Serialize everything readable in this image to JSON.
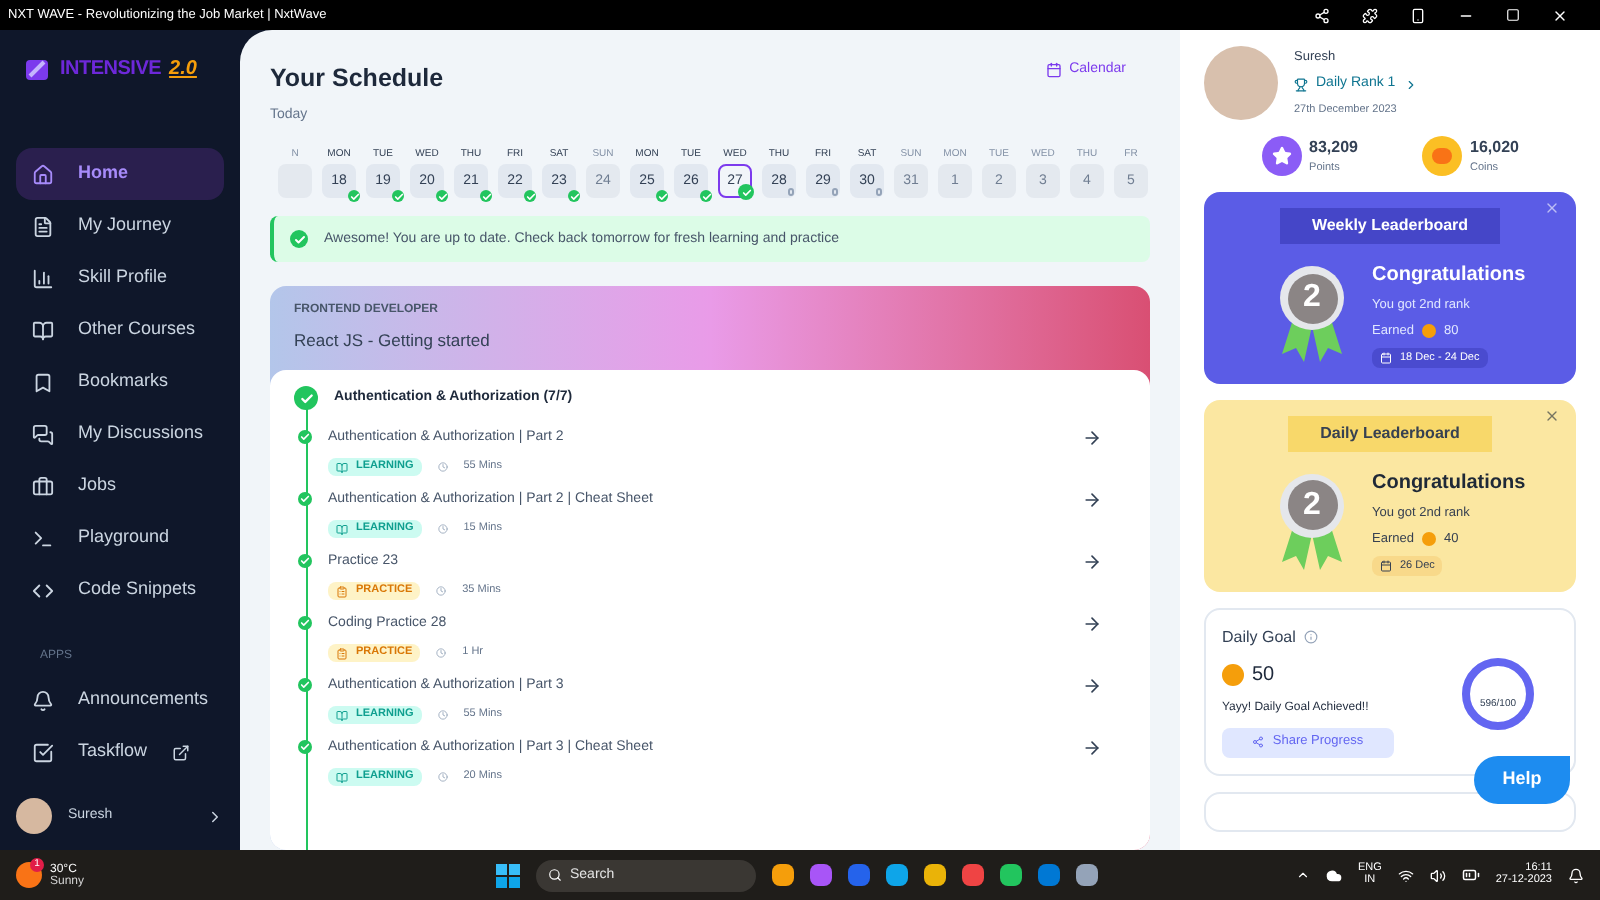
{
  "window": {
    "title": "NXT WAVE - Revolutionizing the Job Market | NxtWave"
  },
  "sidebar": {
    "logo": {
      "word": "INTENSIVE",
      "version": "2.0"
    },
    "items": [
      {
        "label": "Home",
        "selected": true
      },
      {
        "label": "My Journey",
        "selected": false
      },
      {
        "label": "Skill Profile",
        "selected": false
      },
      {
        "label": "Other Courses",
        "selected": false
      },
      {
        "label": "Bookmarks",
        "selected": false
      },
      {
        "label": "My Discussions",
        "selected": false
      },
      {
        "label": "Jobs",
        "selected": false
      },
      {
        "label": "Playground",
        "selected": false
      },
      {
        "label": "Code Snippets",
        "selected": false
      }
    ],
    "section_title": "APPS",
    "apps": [
      {
        "label": "Announcements",
        "selected": false
      },
      {
        "label": "Taskflow",
        "external": true,
        "selected": false
      }
    ],
    "user": {
      "name": "Suresh"
    }
  },
  "schedule": {
    "title": "Your Schedule",
    "subtitle": "Today",
    "calendar_link": "Calendar",
    "days": [
      {
        "day": "N",
        "kind": "none",
        "muted": true,
        "selected": false
      },
      {
        "day": "MON",
        "date": "18",
        "kind": "done",
        "muted": false,
        "selected": false
      },
      {
        "day": "TUE",
        "date": "19",
        "kind": "done",
        "muted": false,
        "selected": false
      },
      {
        "day": "WED",
        "date": "20",
        "kind": "done",
        "muted": false,
        "selected": false
      },
      {
        "day": "THU",
        "date": "21",
        "kind": "done",
        "muted": false,
        "selected": false
      },
      {
        "day": "FRI",
        "date": "22",
        "kind": "done",
        "muted": false,
        "selected": false
      },
      {
        "day": "SAT",
        "date": "23",
        "kind": "done",
        "muted": false,
        "selected": false
      },
      {
        "day": "SUN",
        "date": "24",
        "kind": "none",
        "muted": true,
        "selected": false
      },
      {
        "day": "MON",
        "date": "25",
        "kind": "done",
        "muted": false,
        "selected": false
      },
      {
        "day": "TUE",
        "date": "26",
        "kind": "done",
        "muted": false,
        "selected": false
      },
      {
        "day": "WED",
        "date": "27",
        "kind": "done",
        "muted": false,
        "selected": true
      },
      {
        "day": "THU",
        "date": "28",
        "kind": "pending",
        "muted": false,
        "selected": false
      },
      {
        "day": "FRI",
        "date": "29",
        "kind": "pending",
        "muted": false,
        "selected": false
      },
      {
        "day": "SAT",
        "date": "30",
        "kind": "pending",
        "muted": false,
        "selected": false
      },
      {
        "day": "SUN",
        "date": "31",
        "kind": "none",
        "muted": true,
        "selected": false
      },
      {
        "day": "MON",
        "date": "1",
        "kind": "none",
        "muted": true,
        "selected": false
      },
      {
        "day": "TUE",
        "date": "2",
        "kind": "none",
        "muted": true,
        "selected": false
      },
      {
        "day": "WED",
        "date": "3",
        "kind": "none",
        "muted": true,
        "selected": false
      },
      {
        "day": "THU",
        "date": "4",
        "kind": "none",
        "muted": true,
        "selected": false
      },
      {
        "day": "FR",
        "date": "5",
        "kind": "none",
        "muted": true,
        "selected": false
      }
    ],
    "banner": "Awesome! You are up to date. Check back tomorrow for fresh learning and practice",
    "course": {
      "track": "FRONTEND DEVELOPER",
      "title": "React JS - Getting started",
      "section": {
        "title": "Authentication & Authorization (7/7)",
        "done": true
      },
      "tasks": [
        {
          "title": "Authentication & Authorization | Part 2",
          "kind": "learning",
          "tag": "LEARNING",
          "duration": "55 Mins",
          "done": true
        },
        {
          "title": "Authentication & Authorization | Part 2 | Cheat Sheet",
          "kind": "learning",
          "tag": "LEARNING",
          "duration": "15 Mins",
          "done": true
        },
        {
          "title": "Practice 23",
          "kind": "practice",
          "tag": "PRACTICE",
          "duration": "35 Mins",
          "done": true
        },
        {
          "title": "Coding Practice 28",
          "kind": "practice",
          "tag": "PRACTICE",
          "duration": "1 Hr",
          "done": true
        },
        {
          "title": "Authentication & Authorization | Part 3",
          "kind": "learning",
          "tag": "LEARNING",
          "duration": "55 Mins",
          "done": true
        },
        {
          "title": "Authentication & Authorization | Part 3 | Cheat Sheet",
          "kind": "learning",
          "tag": "LEARNING",
          "duration": "20 Mins",
          "done": true
        }
      ]
    }
  },
  "profile": {
    "name": "Suresh",
    "rank": "Daily Rank 1",
    "date": "27th December 2023",
    "stats": [
      {
        "kind": "points",
        "value": "83,209",
        "label": "Points"
      },
      {
        "kind": "coins",
        "value": "16,020",
        "label": "Coins"
      }
    ]
  },
  "leaderboards": [
    {
      "kind": "weekly",
      "title": "Weekly Leaderboard",
      "rank": "2",
      "heading": "Congratulations",
      "message": "You got 2nd rank",
      "earned_label": "Earned",
      "earned": "80",
      "period": "18 Dec - 24 Dec"
    },
    {
      "kind": "daily",
      "title": "Daily Leaderboard",
      "rank": "2",
      "heading": "Congratulations",
      "message": "You got 2nd rank",
      "earned_label": "Earned",
      "earned": "40",
      "period": "26 Dec"
    }
  ],
  "daily_goal": {
    "title": "Daily Goal",
    "coins": "50",
    "message": "Yayy! Daily Goal Achieved!!",
    "button": "Share Progress",
    "reading": "596/100",
    "level": 1
  },
  "help": "Help",
  "taskbar": {
    "weather": {
      "temp": "30°C",
      "condition": "Sunny",
      "alerts": "1"
    },
    "search": {
      "placeholder": "Search"
    },
    "language": "ENG",
    "region": "IN",
    "time": "16:11",
    "date": "27-12-2023"
  }
}
